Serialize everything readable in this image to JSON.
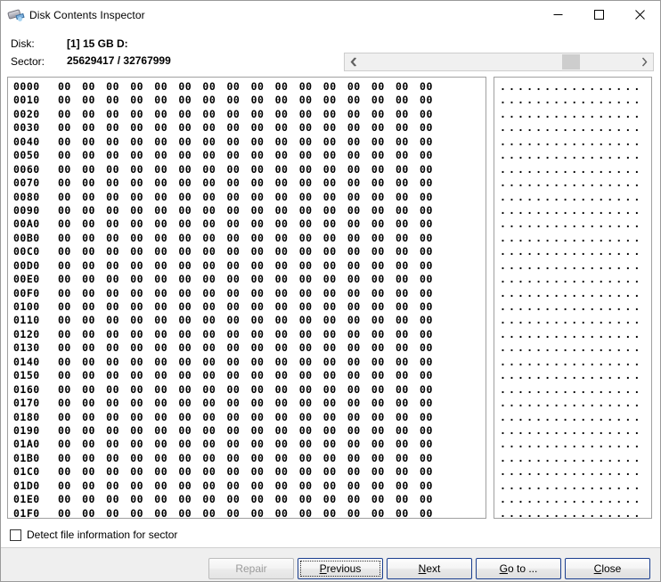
{
  "window": {
    "title": "Disk Contents Inspector",
    "icon": "disk-inspector-icon",
    "controls": {
      "minimize": "minimize-icon",
      "maximize": "maximize-icon",
      "close": "close-icon"
    }
  },
  "info": {
    "disk_label": "Disk:",
    "disk_value": "[1] 15 GB D:",
    "sector_label": "Sector:",
    "sector_value": "25629417 / 32767999"
  },
  "scrollbar": {
    "left_arrow": "chevron-left-icon",
    "right_arrow": "chevron-right-icon",
    "thumb_position_percent": 78
  },
  "hex_view": {
    "bytes_per_row": 16,
    "row_count": 32,
    "offsets": [
      "0000",
      "0010",
      "0020",
      "0030",
      "0040",
      "0050",
      "0060",
      "0070",
      "0080",
      "0090",
      "00A0",
      "00B0",
      "00C0",
      "00D0",
      "00E0",
      "00F0",
      "0100",
      "0110",
      "0120",
      "0130",
      "0140",
      "0150",
      "0160",
      "0170",
      "0180",
      "0190",
      "01A0",
      "01B0",
      "01C0",
      "01D0",
      "01E0",
      "01F0"
    ],
    "bytes_row": "00 00 00 00 00 00 00 00 00 00 00 00 00 00 00 00",
    "ascii_row": "................"
  },
  "options": {
    "detect_file_info_label": "Detect file information for sector",
    "detect_file_info_checked": false
  },
  "buttons": {
    "repair": {
      "label": "Repair",
      "accel": "",
      "disabled": true,
      "focused": false
    },
    "previous": {
      "label": "Previous",
      "accel": "P",
      "disabled": false,
      "focused": true
    },
    "next": {
      "label": "Next",
      "accel": "N",
      "disabled": false,
      "focused": false
    },
    "goto": {
      "label": "Go to ...",
      "accel": "G",
      "disabled": false,
      "focused": false
    },
    "close": {
      "label": "Close",
      "accel": "C",
      "disabled": false,
      "focused": false
    }
  },
  "colors": {
    "dialog_bg": "#ffffff",
    "footer_bg": "#efefef",
    "button_border_focus": "#1b3f8f",
    "panel_border": "#a0a0a0",
    "scroll_thumb": "#cdcdcd"
  }
}
